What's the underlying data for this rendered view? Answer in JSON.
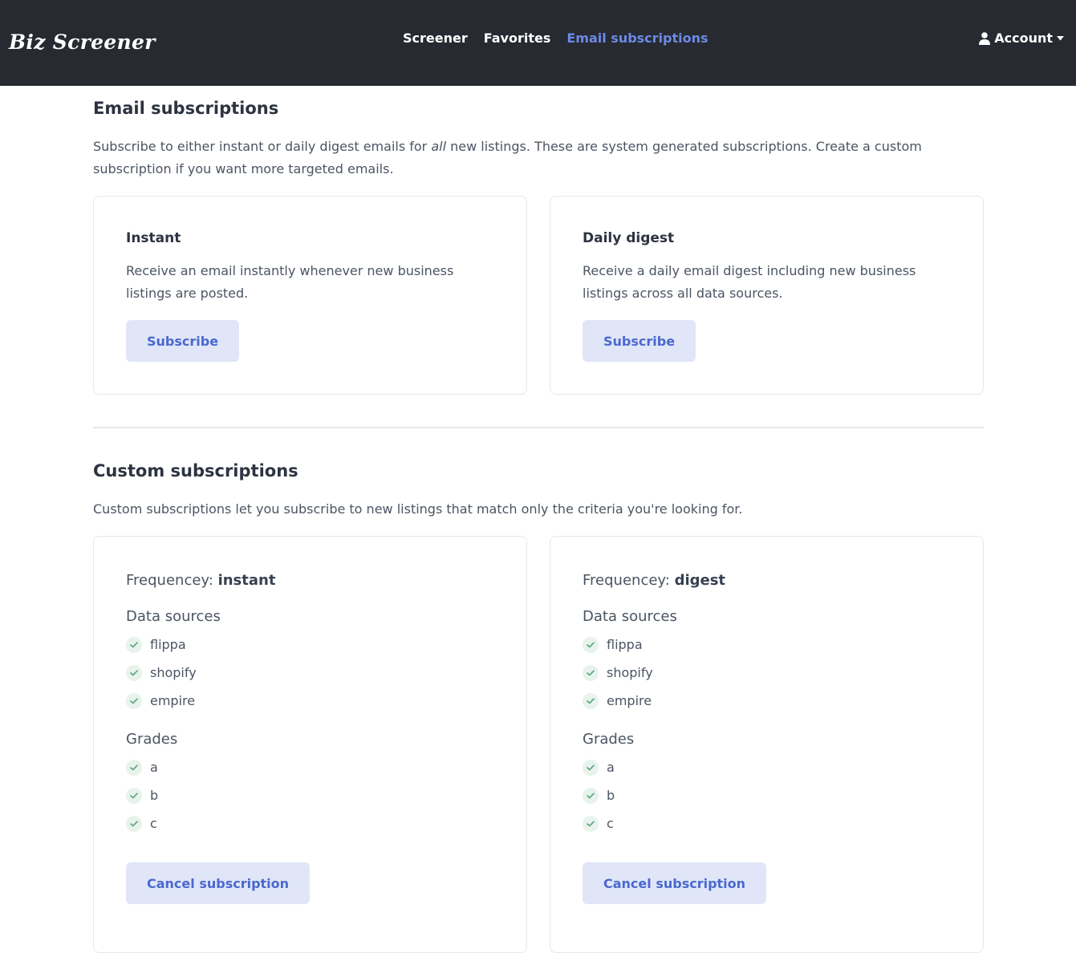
{
  "navbar": {
    "logo": "Biz Screener",
    "links": [
      "Screener",
      "Favorites",
      "Email subscriptions"
    ],
    "account_label": "Account",
    "active_color": "#6b8ae6"
  },
  "email_subscriptions": {
    "title": "Email subscriptions",
    "desc_part1": "Subscribe to either instant or daily digest emails for ",
    "desc_em": "all",
    "desc_part2": " new listings. These are system generated subscriptions. Create a custom subscription if you want more targeted emails.",
    "cards": [
      {
        "title": "Instant",
        "desc": "Receive an email instantly whenever new business listings are posted.",
        "button": "Subscribe"
      },
      {
        "title": "Daily digest",
        "desc": "Receive a daily email digest including new business listings across all data sources.",
        "button": "Subscribe"
      }
    ]
  },
  "custom_subscriptions": {
    "title": "Custom subscriptions",
    "desc": "Custom subscriptions let you subscribe to new listings that match only the criteria you're looking for.",
    "frequency_label": "Frequencey:",
    "data_sources_label": "Data sources",
    "grades_label": "Grades",
    "cards": [
      {
        "frequency": "instant",
        "data_sources": [
          "flippa",
          "shopify",
          "empire"
        ],
        "grades": [
          "a",
          "b",
          "c"
        ],
        "button": "Cancel subscription"
      },
      {
        "frequency": "digest",
        "data_sources": [
          "flippa",
          "shopify",
          "empire"
        ],
        "grades": [
          "a",
          "b",
          "c"
        ],
        "button": "Cancel subscription"
      }
    ]
  },
  "colors": {
    "navbar_bg": "#272a30",
    "button_bg": "#e0e6f8",
    "button_text": "#4a68cf",
    "check_bg": "#e7f3ec",
    "check_mark": "#5aa37a"
  }
}
